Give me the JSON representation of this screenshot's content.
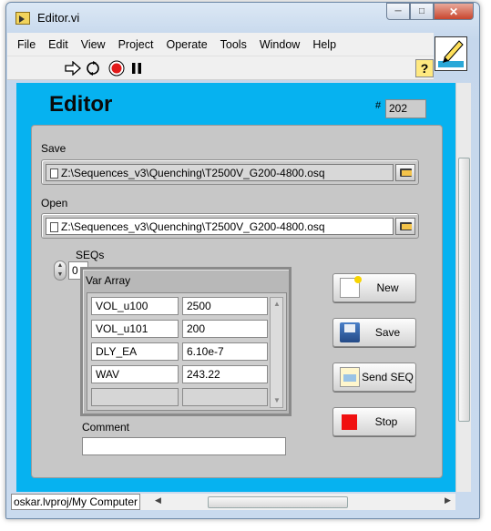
{
  "window": {
    "title": "Editor.vi"
  },
  "menu": [
    "File",
    "Edit",
    "View",
    "Project",
    "Operate",
    "Tools",
    "Window",
    "Help"
  ],
  "toolbar": {
    "help_glyph": "?"
  },
  "panel": {
    "heading": "Editor",
    "number_label": "#",
    "number_value": "202",
    "save": {
      "label": "Save",
      "path": "Z:\\Sequences_v3\\Quenching\\T2500V_G200-4800.osq"
    },
    "open": {
      "label": "Open",
      "path": "Z:\\Sequences_v3\\Quenching\\T2500V_G200-4800.osq"
    },
    "seqs": {
      "label": "SEQs",
      "index": "0"
    },
    "var_array": {
      "label": "Var Array",
      "rows": [
        {
          "name": "VOL_u100",
          "value": "2500"
        },
        {
          "name": "VOL_u101",
          "value": "200"
        },
        {
          "name": "DLY_EA",
          "value": "6.10e-7"
        },
        {
          "name": "WAV",
          "value": "243.22"
        }
      ]
    },
    "comment": {
      "label": "Comment",
      "value": ""
    },
    "buttons": {
      "new": "New",
      "save": "Save",
      "send_seq": "Send SEQ",
      "stop": "Stop"
    }
  },
  "status": {
    "context": "oskar.lvproj/My Computer"
  }
}
